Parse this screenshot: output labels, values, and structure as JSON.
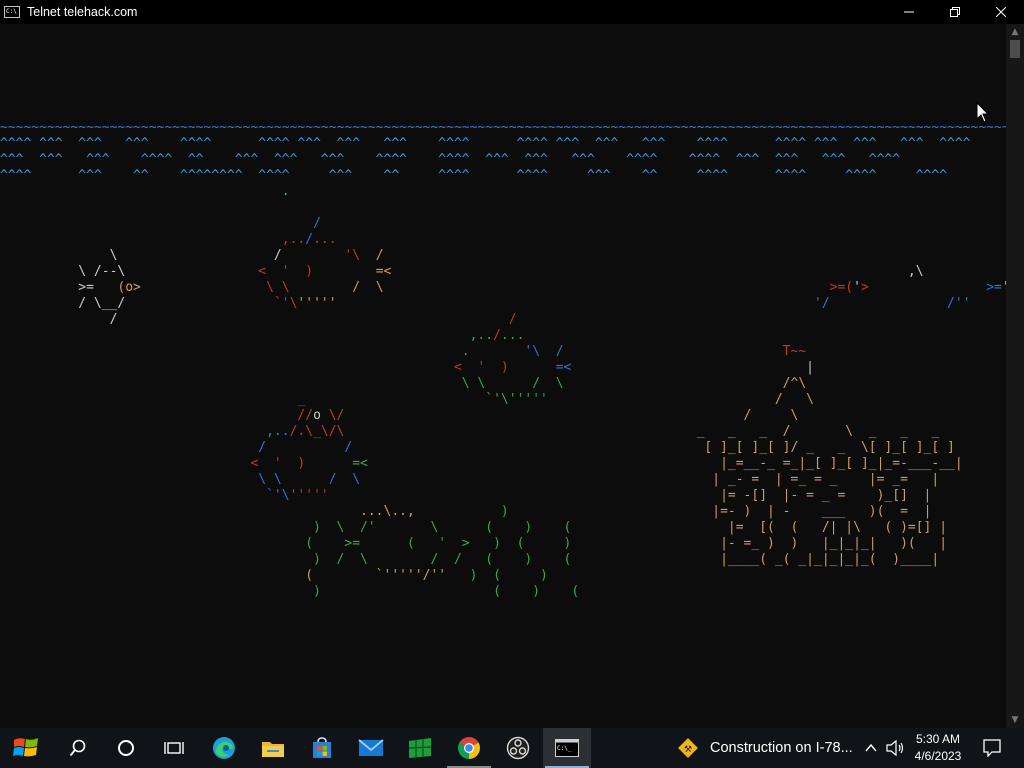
{
  "window": {
    "title": "Telnet telehack.com",
    "app_icon_text": "C:\\"
  },
  "aquarium": {
    "lines": [
      [],
      [],
      [],
      [
        {
          "t": "                                                                                                                                          )",
          "c": "#cccccc"
        }
      ],
      [
        {
          "t": "                                                                                                                                         )_",
          "c": "#cccccc"
        }
      ],
      [
        {
          "t": "                                                                                                                                       _____",
          "c": "#c8a15a"
        }
      ],
      [
        {
          "t": "~~~~~~~~~~~~~~~~~~~~~~~~~~~~~~~~~~~~~~~~~~~~~~~~~~~~~~~~~~~~~~~~~~~~~~~~~~~~~~~~~~~~~~~~~~~~~~~~~~~~~~~~~~~~~~~~~~~~~~~~~~~~~~~~~~~~~~~~~~",
          "c": "#3a7bd5"
        },
        {
          "t": "\\",
          "c": "#c8a15a"
        }
      ],
      [
        {
          "t": "^^^^ ^^^  ^^^   ^^^    ^^^^      ^^^^ ^^^  ^^^   ^^^    ^^^^      ^^^^ ^^^  ^^^   ^^^    ^^^^      ^^^^ ^^^  ^^^   ^^^  ^^^^",
          "c": "#3a9ad9"
        }
      ],
      [
        {
          "t": "^^^  ^^^   ^^^    ^^^^  ^^    ^^^  ^^^   ^^^    ^^^^    ^^^^  ^^^  ^^^   ^^^    ^^^^    ^^^^  ^^^  ^^^   ^^^   ^^^^",
          "c": "#3a9ad9"
        }
      ],
      [
        {
          "t": "^^^^      ^^^    ^^    ^^^^^^^^  ^^^^     ^^^    ^^     ^^^^      ^^^^     ^^^    ^^     ^^^^      ^^^^     ^^^^     ^^^^",
          "c": "#3a9ad9"
        }
      ],
      [
        {
          "t": "                                    .",
          "c": "#3bb3b3"
        }
      ],
      [],
      [
        {
          "t": "                                        /",
          "c": "#3a6fd8"
        }
      ],
      [
        {
          "t": "                                    ,..",
          "c": "#c0392b"
        },
        {
          "t": "/",
          "c": "#3a6fd8"
        },
        {
          "t": "...",
          "c": "#c0392b"
        }
      ],
      [
        {
          "t": "              \\                    /        ",
          "c": "#cccccc"
        },
        {
          "t": "'\\  ",
          "c": "#c0392b"
        },
        {
          "t": "/",
          "c": "#c8a15a"
        }
      ],
      [
        {
          "t": "          \\ /--\\                 ",
          "c": "#cccccc"
        },
        {
          "t": "<  '  )",
          "c": "#c0392b"
        },
        {
          "t": "        =<",
          "c": "#c8a15a"
        },
        {
          "t": "                                                                  ,\\",
          "c": "#cccccc"
        },
        {
          "t": "                ",
          "c": "#cccccc"
        },
        {
          "t": "/ \\",
          "c": "#c0392b"
        }
      ],
      [
        {
          "t": "          >=   ",
          "c": "#cccccc"
        },
        {
          "t": "(o>",
          "c": "#c8a15a"
        },
        {
          "t": "                ",
          "c": "#cccccc"
        },
        {
          "t": "\\ \\",
          "c": "#c0392b"
        },
        {
          "t": "        /  \\",
          "c": "#c8a15a"
        },
        {
          "t": "                                                         >=(",
          "c": "#c0392b"
        },
        {
          "t": "'",
          "c": "#cccccc"
        },
        {
          "t": ">",
          "c": "#c0392b"
        },
        {
          "t": "               >=",
          "c": "#3a6fd8"
        },
        {
          "t": "'",
          "c": "#cccccc"
        }
      ],
      [
        {
          "t": "          / \\__/                   ",
          "c": "#cccccc"
        },
        {
          "t": "`'\\",
          "c": "#c0392b"
        },
        {
          "t": "'''''",
          "c": "#c8a15a"
        },
        {
          "t": "                                                             '/",
          "c": "#3a6fd8"
        },
        {
          "t": "               /''",
          "c": "#3a6fd8"
        }
      ],
      [
        {
          "t": "              /                                                  ",
          "c": "#cccccc"
        },
        {
          "t": "/",
          "c": "#c0392b"
        }
      ],
      [
        {
          "t": "                                                            ,..",
          "c": "#3aa655"
        },
        {
          "t": "/",
          "c": "#c0392b"
        },
        {
          "t": "...",
          "c": "#3aa655"
        }
      ],
      [
        {
          "t": "                                                           .       ",
          "c": "#3aa655"
        },
        {
          "t": "'\\  /",
          "c": "#3a6fd8"
        },
        {
          "t": "                            T~~",
          "c": "#c0392b"
        }
      ],
      [
        {
          "t": "                                                          <  '  )",
          "c": "#c0392b"
        },
        {
          "t": "      =<",
          "c": "#3a6fd8"
        },
        {
          "t": "                              |",
          "c": "#cccccc"
        }
      ],
      [
        {
          "t": "                                                           \\ \\      /  \\",
          "c": "#3aa655"
        },
        {
          "t": "                            /^\\",
          "c": "#c8a15a"
        }
      ],
      [
        {
          "t": "                                      _",
          "c": "#c0392b"
        },
        {
          "t": "                       `'\\",
          "c": "#3aa655"
        },
        {
          "t": "'''''",
          "c": "#3aa655"
        },
        {
          "t": "                             /   \\",
          "c": "#c8a15a"
        }
      ],
      [
        {
          "t": "                                      //",
          "c": "#c0392b"
        },
        {
          "t": "o",
          "c": "#cccccc"
        },
        {
          "t": " \\/",
          "c": "#c0392b"
        },
        {
          "t": "                                                   /     \\",
          "c": "#c8a15a"
        }
      ],
      [
        {
          "t": "                                  ,..",
          "c": "#3a6fd8"
        },
        {
          "t": "/.\\_\\/\\",
          "c": "#c0392b"
        },
        {
          "t": "                                             _   _   _  /       \\  _   _   _",
          "c": "#c8a15a"
        }
      ],
      [
        {
          "t": "                                 /          ",
          "c": "#3a6fd8"
        },
        {
          "t": "/",
          "c": "#3a6fd8"
        },
        {
          "t": "                                             [ ]_[ ]_[ ]/ _   _  \\[ ]_[ ]_[ ]",
          "c": "#c8a15a"
        }
      ],
      [
        {
          "t": "                                <  '  )",
          "c": "#c0392b"
        },
        {
          "t": "      =<",
          "c": "#3aa655"
        },
        {
          "t": "                                             |_=__-_ =_|_[ ]_[ ]_|_=-___-__|",
          "c": "#c8a15a"
        }
      ],
      [
        {
          "t": "                                 \\ \\      /  \\",
          "c": "#3a6fd8"
        },
        {
          "t": "                                             | _- =  | =_ = _    |= _=   |",
          "c": "#c8a15a"
        }
      ],
      [
        {
          "t": "                                  `'\\",
          "c": "#3a6fd8"
        },
        {
          "t": "'''''",
          "c": "#c0392b"
        },
        {
          "t": "                                                  |= -[]  |- = _ =    )_[]  |",
          "c": "#c8a15a"
        }
      ],
      [
        {
          "t": "                                              ...\\..,",
          "c": "#c8a15a"
        },
        {
          "t": "           )",
          "c": "#3aa655"
        },
        {
          "t": "                          |=- )  | -    ___   )(  =  |",
          "c": "#c8a15a"
        }
      ],
      [
        {
          "t": "                                        )  \\  /'       \\",
          "c": "#3aa655"
        },
        {
          "t": "      (    )    (",
          "c": "#3aa655"
        },
        {
          "t": "                    |=  [(  (   /| |\\   ( )=[] |",
          "c": "#c8a15a"
        }
      ],
      [
        {
          "t": "                                       (    >=      (   '  >",
          "c": "#3aa655"
        },
        {
          "t": "   )  (     )",
          "c": "#3aa655"
        },
        {
          "t": "                   |- =_ )  )   |_|_|_|   )(   |",
          "c": "#c8a15a"
        }
      ],
      [
        {
          "t": "                                        )  /  \\        /  /",
          "c": "#3aa655"
        },
        {
          "t": "   (    )    (",
          "c": "#3aa655"
        },
        {
          "t": "                   |____( _( _|_|_|_|_(  )____|",
          "c": "#c8a15a"
        }
      ],
      [
        {
          "t": "                                       (        `'''''/''",
          "c": "#c8a15a"
        },
        {
          "t": "   )  (     )",
          "c": "#3aa655"
        }
      ],
      [
        {
          "t": "                                        )",
          "c": "#3aa655"
        },
        {
          "t": "                      (    )    (",
          "c": "#3aa655"
        }
      ]
    ]
  },
  "taskbar": {
    "start_label": "Start",
    "news_text": "Construction on I-78...",
    "clock_time": "5:30 AM",
    "clock_date": "4/6/2023"
  },
  "colors": {
    "console_bg": "#0c0c0c",
    "wave_blue": "#3a9ad9",
    "castle_gold": "#c8a15a",
    "weed_green": "#3aa655",
    "fish_red": "#c0392b",
    "fish_blue": "#3a6fd8"
  }
}
